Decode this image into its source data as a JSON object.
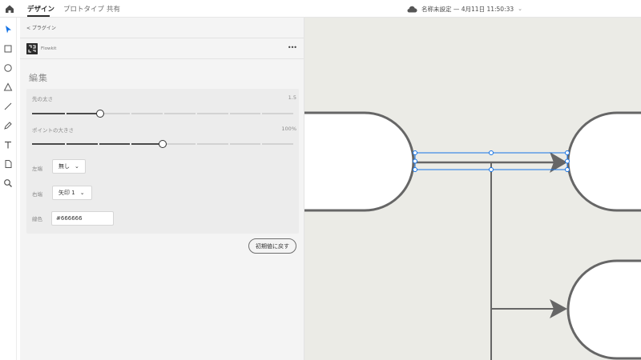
{
  "topbar": {
    "tabs": [
      {
        "label": "デザイン",
        "active": true
      },
      {
        "label": "プロトタイプ",
        "active": false
      },
      {
        "label": "共有",
        "active": false
      }
    ],
    "document_title": "名称未設定 — 4月11日 11:50:33"
  },
  "toolbar": {
    "tools": [
      "select-arrow-icon",
      "rectangle-icon",
      "ellipse-icon",
      "polygon-icon",
      "line-icon",
      "pen-icon",
      "text-icon",
      "artboard-icon",
      "zoom-icon"
    ]
  },
  "panel": {
    "breadcrumb": "< プラグイン",
    "plugin_name": "Flowkit",
    "more_label": "•••",
    "section_title": "編集",
    "line_width": {
      "label": "先の太さ",
      "value_text": "1.5",
      "fraction": 0.26
    },
    "point_size": {
      "label": "ポイントの大きさ",
      "value_text": "100%",
      "fraction": 0.5
    },
    "left_end": {
      "label": "左端",
      "value": "無し"
    },
    "right_end": {
      "label": "右端",
      "value": "矢印 1"
    },
    "color": {
      "label": "線色",
      "value": "#666666"
    },
    "reset_label": "初期値に戻す"
  },
  "colors": {
    "accent": "#1473e6",
    "line": "#666666",
    "canvas_bg": "#ebebe6",
    "panel_bg": "#f4f4f4"
  }
}
